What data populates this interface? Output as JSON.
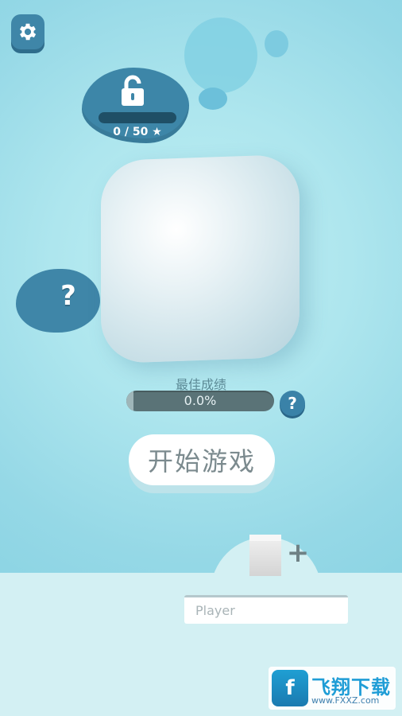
{
  "colors": {
    "accent_blue": "#3f86a8",
    "progress_bg": "#5a7377",
    "start_button_bg": "#ffffff",
    "panel_bg": "#d3f0f3"
  },
  "settings": {
    "icon": "gear-icon"
  },
  "lock_blob": {
    "icon": "lock-icon",
    "progress_text": "0 / 50 ★",
    "progress_fraction": 0
  },
  "help_blob": {
    "label": "?"
  },
  "best_score": {
    "label": "最佳成绩",
    "value_text": "0.0%",
    "fraction": 0,
    "help_label": "?"
  },
  "start_button": {
    "label": "开始游戏"
  },
  "skin_selector": {
    "plus_label": "+"
  },
  "player_input": {
    "placeholder": "Player",
    "value": ""
  },
  "watermark": {
    "title": "飞翔下载",
    "url": "www.FXXZ.com",
    "logo_glyph": "f"
  }
}
